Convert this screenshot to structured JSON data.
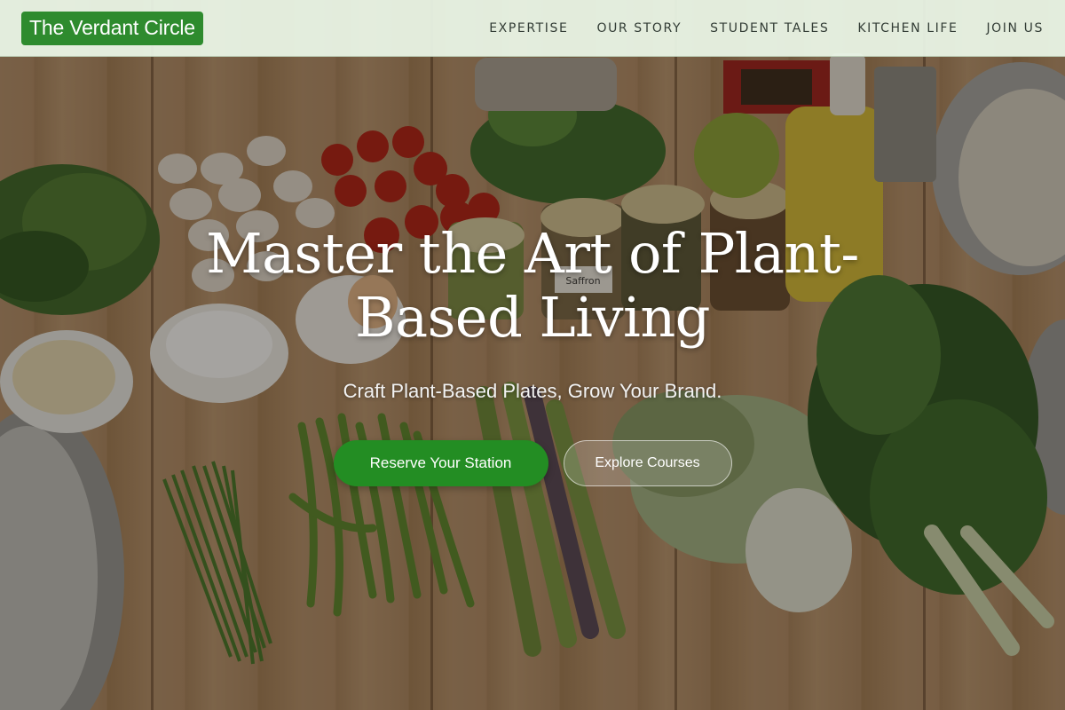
{
  "header": {
    "logo_text": "The Verdant Circle",
    "nav": [
      {
        "label": "EXPERTISE"
      },
      {
        "label": "OUR STORY"
      },
      {
        "label": "STUDENT TALES"
      },
      {
        "label": "KITCHEN LIFE"
      },
      {
        "label": "JOIN US"
      }
    ]
  },
  "hero": {
    "headline": "Master the Art of Plant-Based Living",
    "tagline": "Craft Plant-Based Plates, Grow Your Brand.",
    "primary_cta": "Reserve Your Station",
    "secondary_cta": "Explore Courses",
    "background_image": "vegetables-on-wooden-table",
    "jar_label": "Saffron"
  },
  "colors": {
    "brand_green": "#2e8b2e",
    "cta_green": "#238d23",
    "header_bg": "#ecf8e8",
    "nav_text": "#333d36"
  }
}
